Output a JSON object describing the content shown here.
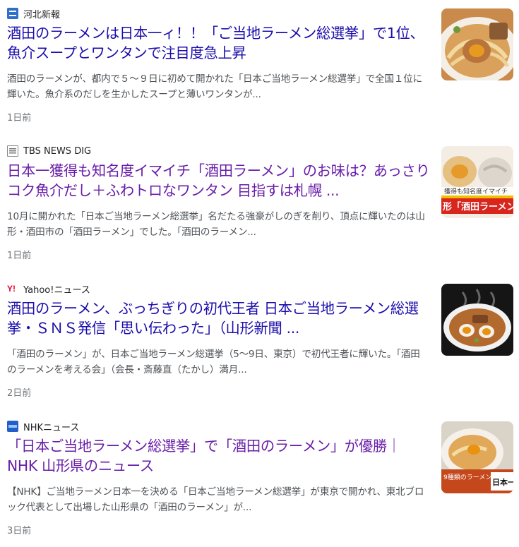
{
  "results": [
    {
      "source": "河北新報",
      "favicon": "kahoku-shimpo-logo-icon",
      "title": "酒田のラーメンは日本一ィ！！「ご当地ラーメン総選挙」で1位、魚介スープとワンタンで注目度急上昇",
      "snippet": "酒田のラーメンが、都内で５～９日に初めて開かれた「日本ご当地ラーメン総選挙」で全国１位に輝いた。魚介系のだしを生かしたスープと薄いワンタンが...",
      "age": "1日前",
      "thumbnail": "ramen-bowl-with-egg-thumbnail"
    },
    {
      "source": "TBS NEWS DIG",
      "favicon": "tbs-news-dig-icon",
      "title": "日本一獲得も知名度イマイチ「酒田ラーメン」のお味は？あっさりコク魚介だし＋ふわトロなワンタン 目指すは札幌 ...",
      "snippet": "10月に開かれた「日本ご当地ラーメン総選挙」名だたる強豪がしのぎを削り、頂点に輝いたのは山形・酒田市の「酒田ラーメン」でした。「酒田のラーメン...",
      "age": "1日前",
      "thumbnail": "tv-news-ramen-thumbnail",
      "thumb_caption": "形「酒田ラーメン」",
      "thumb_subcaption": "獲得も知名度イマイチ"
    },
    {
      "source": "Yahoo!ニュース",
      "favicon": "yahoo-news-icon",
      "title": "酒田のラーメン、ぶっちぎりの初代王者 日本ご当地ラーメン総選挙・ＳＮＳ発信「思い伝わった」（山形新聞 ...",
      "snippet": "「酒田のラーメン」が、日本ご当地ラーメン総選挙（5～9日、東京）で初代王者に輝いた。「酒田のラーメンを考える会」（会長・斎藤直（たかし）満月...",
      "age": "2日前",
      "thumbnail": "steaming-ramen-bowl-thumbnail"
    },
    {
      "source": "NHKニュース",
      "favicon": "nhk-news-icon",
      "title": "「日本ご当地ラーメン総選挙」で「酒田のラーメン」が優勝｜NHK 山形県のニュース",
      "snippet": "【NHK】ご当地ラーメン日本一を決める「日本ご当地ラーメン総選挙」が東京で開かれ、東北ブロック代表として出場した山形県の「酒田のラーメン」が...",
      "age": "3日前",
      "thumbnail": "nhk-ramen-broadcast-thumbnail",
      "thumb_caption": "日本一",
      "thumb_subcaption": "9種類のラーメン"
    }
  ],
  "colors": {
    "link": "#1a0dab",
    "visited": "#681da8",
    "snippet": "#4d5156",
    "meta": "#70757a"
  }
}
